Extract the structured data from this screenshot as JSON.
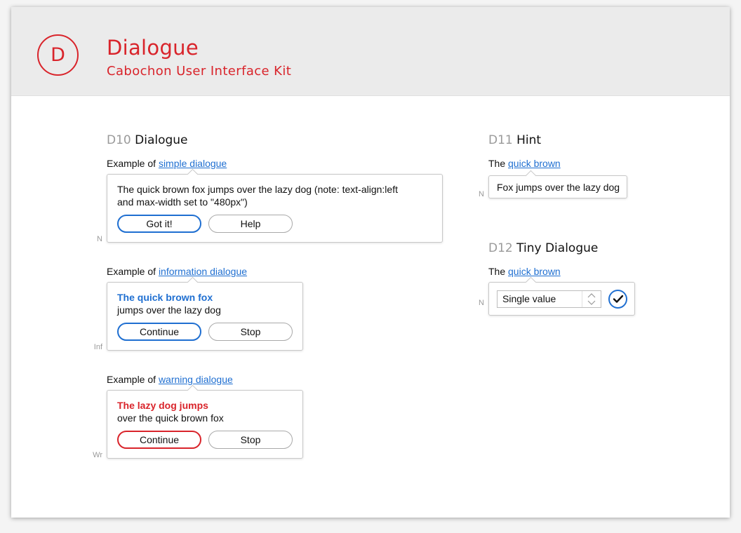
{
  "header": {
    "logo_letter": "D",
    "title": "Dialogue",
    "subtitle": "Cabochon User Interface Kit"
  },
  "sections": {
    "d10": {
      "code": "D10",
      "name": "Dialogue"
    },
    "d11": {
      "code": "D11",
      "name": "Hint"
    },
    "d12": {
      "code": "D12",
      "name": "Tiny Dialogue"
    }
  },
  "simple": {
    "prefix": "Example of",
    "link": "simple dialogue",
    "tag": "N",
    "line1": "The quick brown fox jumps over the lazy dog (note: text-align:left",
    "line2": "and max-width set to \"480px\")",
    "primary_label": "Got it!",
    "secondary_label": "Help"
  },
  "information": {
    "prefix": "Example of",
    "link": "information dialogue",
    "tag": "Inf",
    "heading": "The quick brown fox",
    "body": "jumps over the lazy dog",
    "primary_label": "Continue",
    "secondary_label": "Stop"
  },
  "warning": {
    "prefix": "Example of",
    "link": "warning dialogue",
    "tag": "Wr",
    "heading": "The lazy dog jumps",
    "body": "over the quick brown fox",
    "primary_label": "Continue",
    "secondary_label": "Stop"
  },
  "hint": {
    "prefix": "The",
    "link": "quick brown",
    "tag": "N",
    "text": "Fox jumps over the lazy dog"
  },
  "tiny": {
    "prefix": "The",
    "link": "quick brown",
    "tag": "N",
    "select_value": "Single value"
  },
  "colors": {
    "accent_red": "#d9242b",
    "link_blue": "#1f6fd1"
  },
  "icons": {
    "stepper": "chevron-up-down-icon",
    "confirm": "checkmark-icon"
  }
}
